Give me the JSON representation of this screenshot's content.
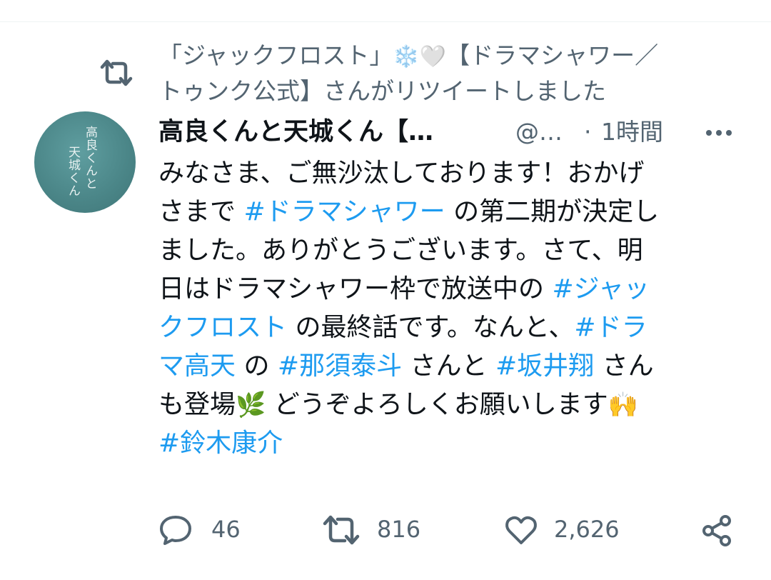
{
  "retweet_context": {
    "line1": "「ジャックフロスト」",
    "emoji1": "❄️",
    "emoji2": "🤍",
    "line1_rest": "【ドラマシャワー／",
    "line2": "トゥンク公式】さんがリツイートしました"
  },
  "tweet": {
    "display_name": "高良くんと天城くん【…",
    "handle": "@…",
    "separator": "·",
    "time": "1時間",
    "lines": [
      [
        {
          "t": "みなさま、ご無沙汰しております！おかげ"
        }
      ],
      [
        {
          "t": "さまで "
        },
        {
          "t": "#ドラマシャワー",
          "tag": true
        },
        {
          "t": " の第二期が決定し"
        }
      ],
      [
        {
          "t": "ました。ありがとうございます。さて、明"
        }
      ],
      [
        {
          "t": "日はドラマシャワー枠で放送中の "
        },
        {
          "t": "#ジャッ",
          "tag": true
        }
      ],
      [
        {
          "t": "クフロスト",
          "tag": true
        },
        {
          "t": " の最終話です。なんと、"
        },
        {
          "t": "#ドラ",
          "tag": true
        }
      ],
      [
        {
          "t": "マ高天",
          "tag": true
        },
        {
          "t": " の "
        },
        {
          "t": "#那須泰斗",
          "tag": true
        },
        {
          "t": " さんと "
        },
        {
          "t": "#坂井翔",
          "tag": true
        },
        {
          "t": " さん"
        }
      ],
      [
        {
          "t": "も登場"
        },
        {
          "t": "🌿",
          "emoji": true
        },
        {
          "t": " どうぞよろしくお願いします"
        },
        {
          "t": "🙌",
          "emoji": true
        }
      ],
      [
        {
          "t": "#鈴木康介",
          "tag": true
        }
      ]
    ]
  },
  "actions": {
    "reply_count": "46",
    "retweet_count": "816",
    "like_count": "2,626"
  },
  "avatar_text": {
    "col1": "高良くんと",
    "col2": "天城くん"
  },
  "colors": {
    "hashtag": "#1d9bf0",
    "secondary_text": "#536471",
    "primary_text": "#0f1419",
    "avatar_bg": "#4a8587"
  },
  "icons": {
    "retweet_context": "retweet-icon",
    "more": "more-dots-icon",
    "reply": "reply-bubble-icon",
    "retweet": "retweet-icon",
    "like": "heart-icon",
    "share": "share-icon"
  }
}
